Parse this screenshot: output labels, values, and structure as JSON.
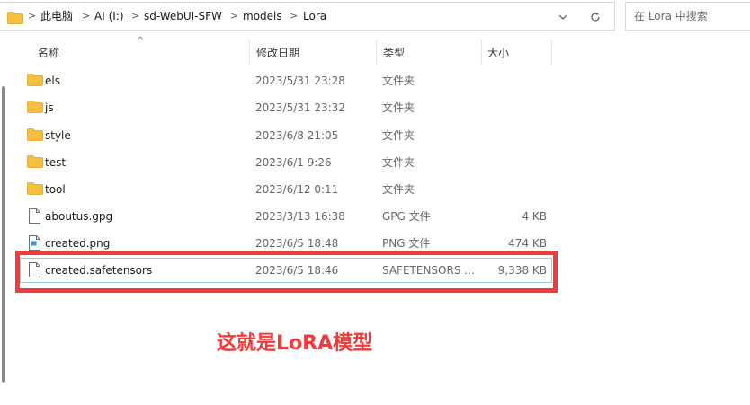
{
  "addressbar": {
    "crumbs": [
      "此电脑",
      "AI (I:)",
      "sd-WebUI-SFW",
      "models",
      "Lora"
    ],
    "separator": ">",
    "dropdown_icon": "chevron-down-icon",
    "refresh_icon": "refresh-icon"
  },
  "search": {
    "placeholder": "在 Lora 中搜索"
  },
  "columns": {
    "name": "名称",
    "date": "修改日期",
    "type": "类型",
    "size": "大小"
  },
  "files": [
    {
      "name": "els",
      "date": "2023/5/31 23:28",
      "type": "文件夹",
      "size": "",
      "icon": "folder-icon"
    },
    {
      "name": "js",
      "date": "2023/5/31 23:32",
      "type": "文件夹",
      "size": "",
      "icon": "folder-icon"
    },
    {
      "name": "style",
      "date": "2023/6/8 21:05",
      "type": "文件夹",
      "size": "",
      "icon": "folder-icon"
    },
    {
      "name": "test",
      "date": "2023/6/1 9:26",
      "type": "文件夹",
      "size": "",
      "icon": "folder-icon"
    },
    {
      "name": "tool",
      "date": "2023/6/12 0:11",
      "type": "文件夹",
      "size": "",
      "icon": "folder-icon"
    },
    {
      "name": "aboutus.gpg",
      "date": "2023/3/13 16:38",
      "type": "GPG 文件",
      "size": "4 KB",
      "icon": "file-icon"
    },
    {
      "name": "created.png",
      "date": "2023/6/5 18:48",
      "type": "PNG 文件",
      "size": "474 KB",
      "icon": "image-file-icon"
    },
    {
      "name": "created.safetensors",
      "date": "2023/6/5 18:46",
      "type": "SAFETENSORS ...",
      "size": "9,338 KB",
      "icon": "file-icon"
    }
  ],
  "annotation": {
    "text": "这就是LoRA模型"
  },
  "colors": {
    "highlight": "#ee3d3d",
    "folder": "#f5c03d",
    "selection_border": "#99c9de"
  }
}
